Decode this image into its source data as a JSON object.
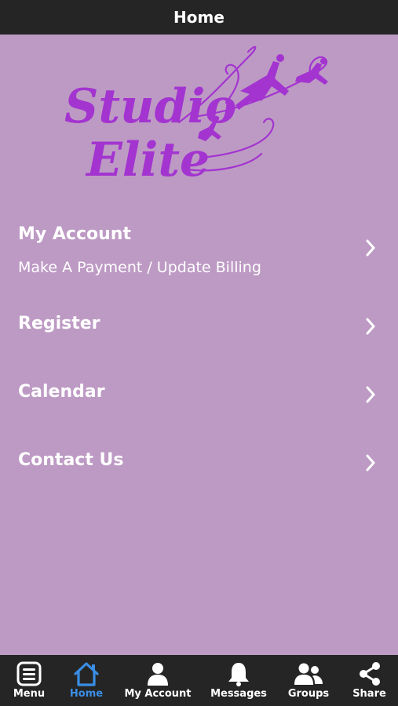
{
  "header": {
    "title": "Home"
  },
  "logo": {
    "line1": "Studio",
    "line2": "Elite"
  },
  "menu": {
    "items": [
      {
        "title": "My Account",
        "subtitle": "Make A Payment / Update Billing"
      },
      {
        "title": "Register"
      },
      {
        "title": "Calendar"
      },
      {
        "title": "Contact Us"
      }
    ]
  },
  "tabbar": {
    "active": "Home",
    "active_color": "#3a8ee6",
    "tabs": [
      {
        "label": "Menu",
        "icon": "menu-icon"
      },
      {
        "label": "Home",
        "icon": "home-icon"
      },
      {
        "label": "My Account",
        "icon": "user-icon"
      },
      {
        "label": "Messages",
        "icon": "bell-icon"
      },
      {
        "label": "Groups",
        "icon": "group-icon"
      },
      {
        "label": "Share",
        "icon": "share-icon"
      }
    ]
  },
  "colors": {
    "background": "#bd9ac4",
    "bar": "#252525",
    "logo": "#a334d0"
  }
}
